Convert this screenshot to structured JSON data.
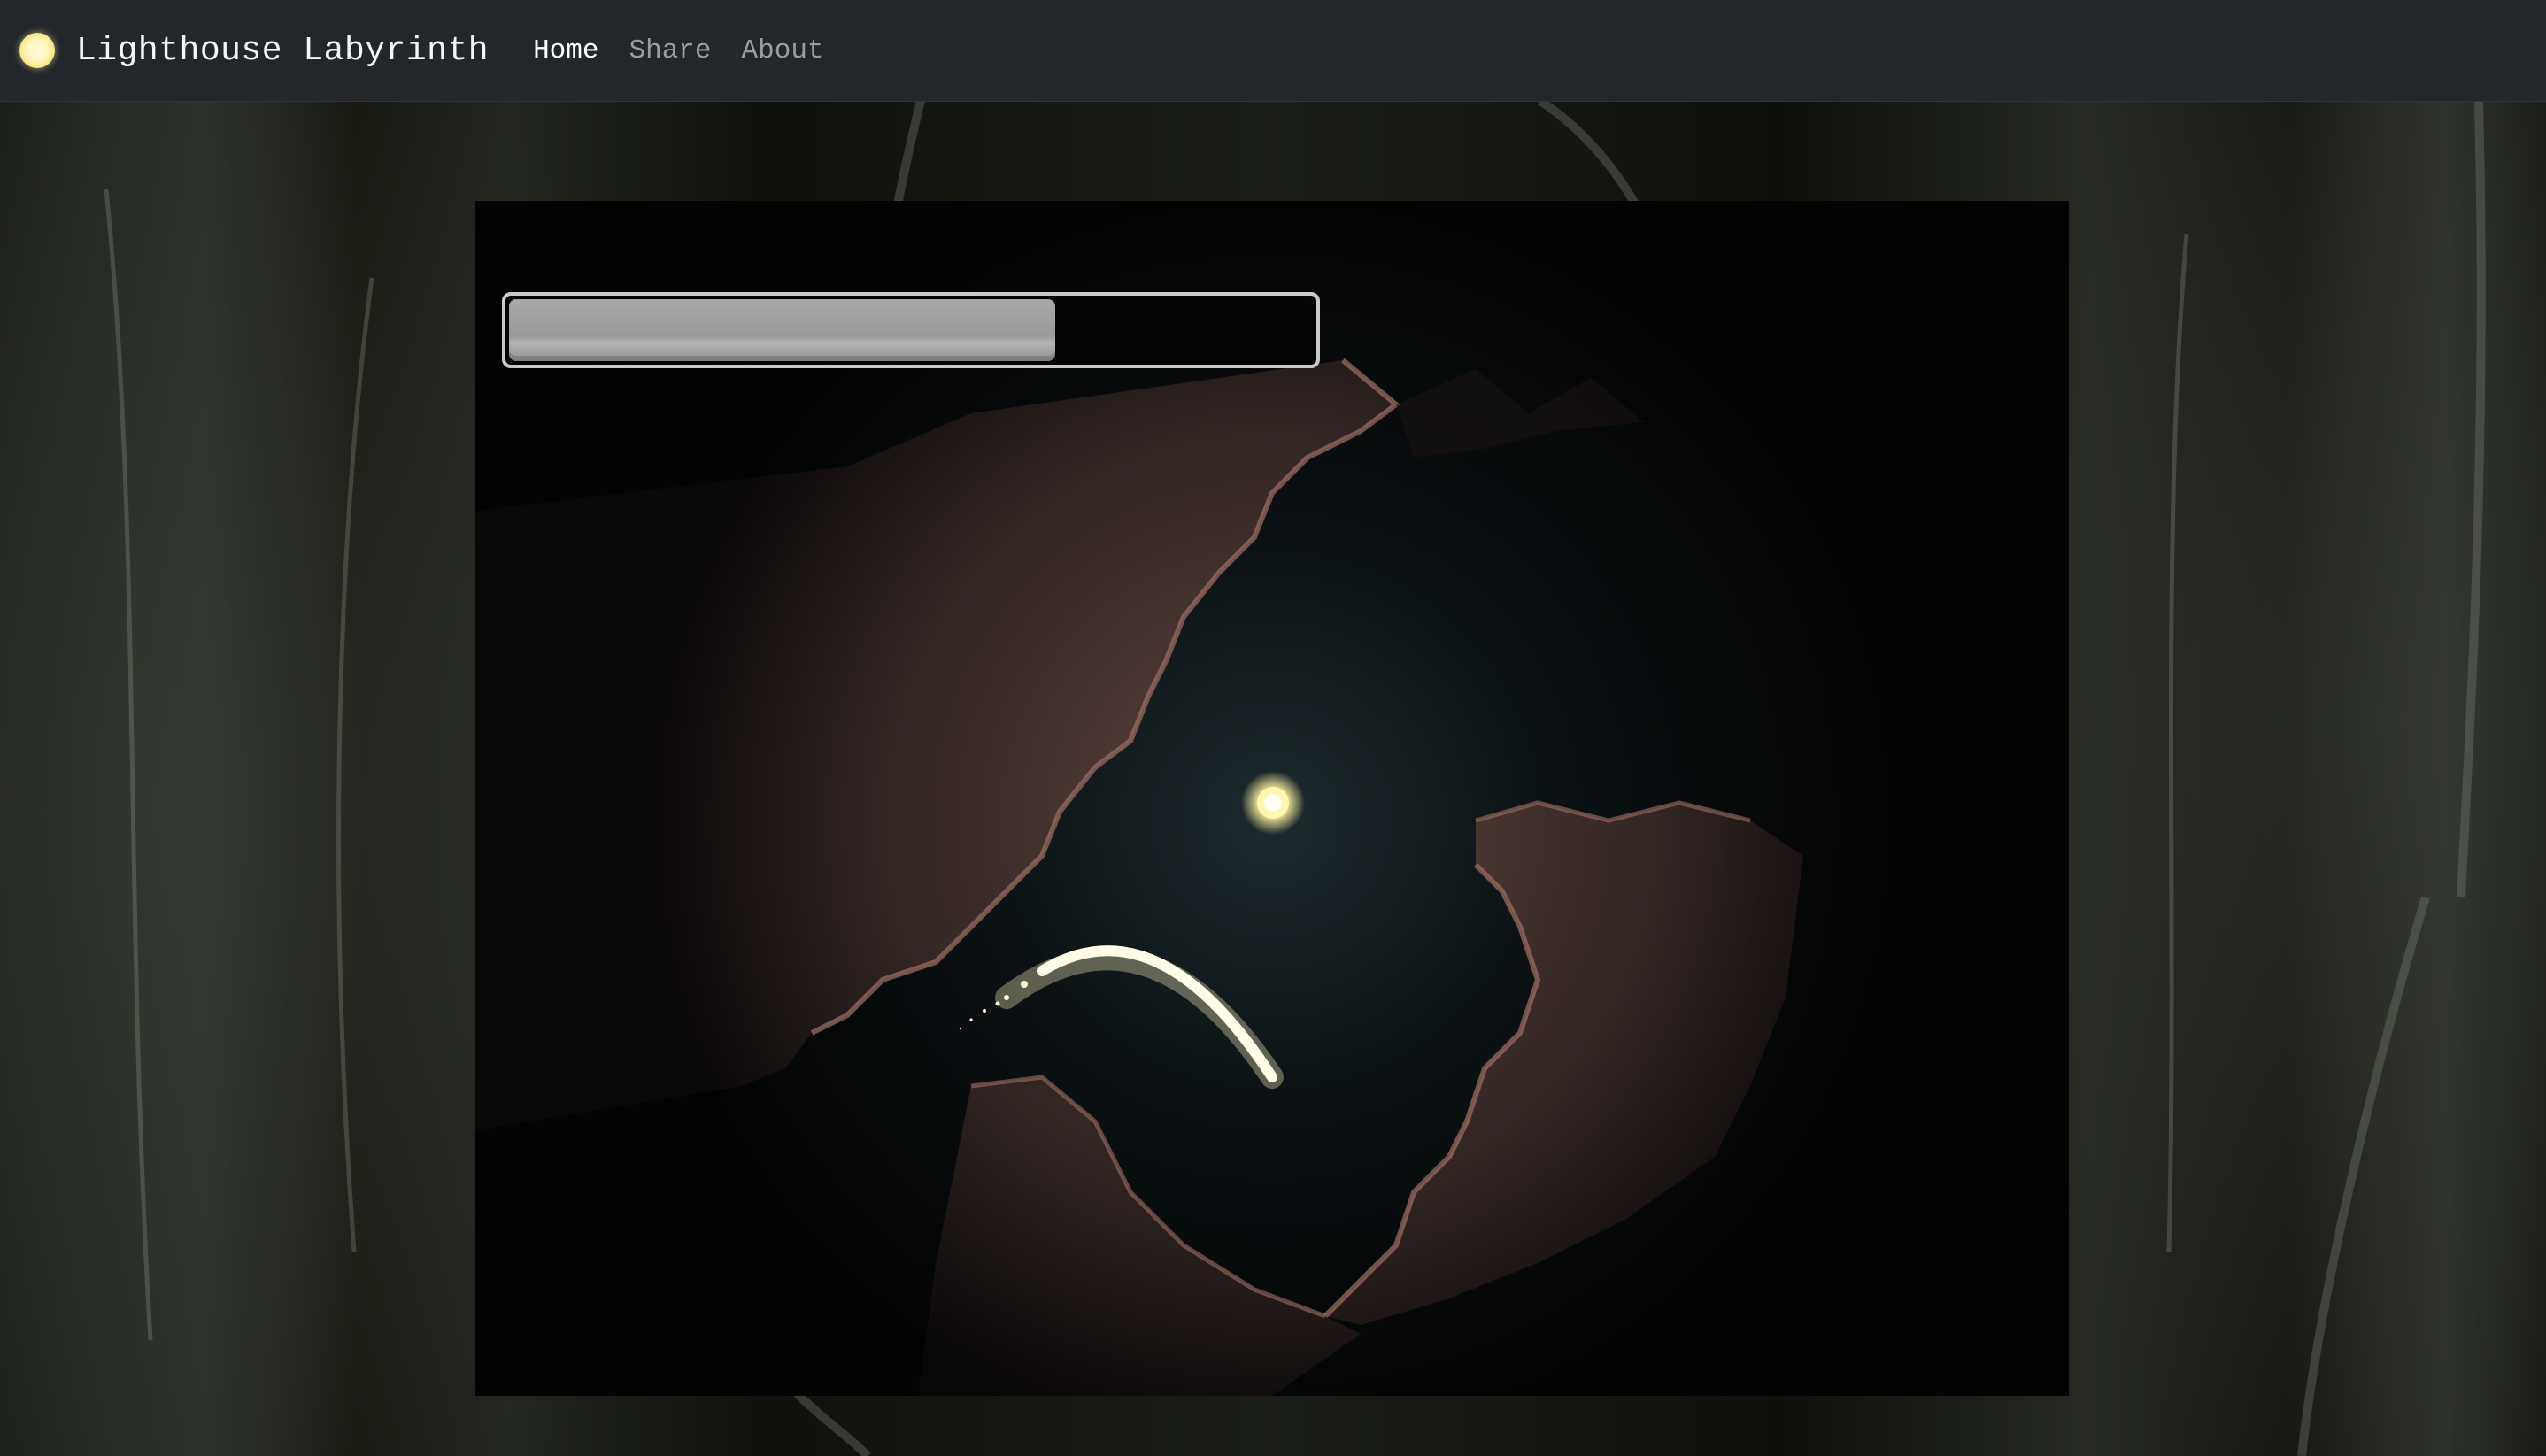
{
  "navbar": {
    "brand": "Lighthouse Labyrinth",
    "brand_icon": "glowing-orb-icon",
    "links": [
      {
        "label": "Home",
        "active": true
      },
      {
        "label": "Share",
        "active": false
      },
      {
        "label": "About",
        "active": false
      }
    ]
  },
  "game": {
    "progress_fraction": 0.68
  },
  "colors": {
    "navbar_bg": "#23272b",
    "orb": "#fff6b0",
    "rock": "#5a3f3a"
  }
}
